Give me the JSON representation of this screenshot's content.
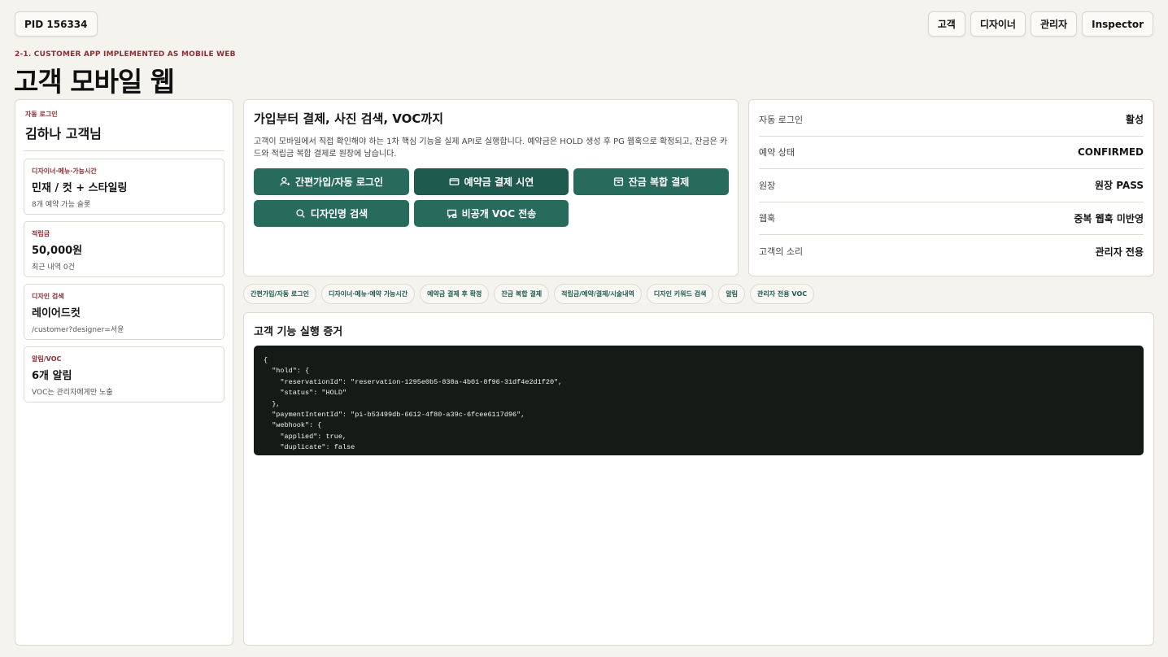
{
  "header": {
    "pid": "PID 156334",
    "roles": [
      "고객",
      "디자이너",
      "관리자",
      "Inspector"
    ],
    "eyebrow": "2-1. CUSTOMER APP IMPLEMENTED AS MOBILE WEB",
    "title": "고객 모바일 웹"
  },
  "left": {
    "login_caption": "자동 로그인",
    "login_name": "김하나 고객님",
    "cards": [
      {
        "caption": "디자이너·메뉴·가능시간",
        "value": "민재 / 컷 + 스타일링",
        "sub": "8개 예약 가능 슬롯"
      },
      {
        "caption": "적립금",
        "value": "50,000원",
        "sub": "최근 내역 0건"
      },
      {
        "caption": "디자인 검색",
        "value": "레이어드컷",
        "sub": "/customer?designer=서윤"
      },
      {
        "caption": "알림/VOC",
        "value": "6개 알림",
        "sub": "VOC는 관리자에게만 노출"
      }
    ]
  },
  "center": {
    "title": "가입부터 결제, 사진 검색, VOC까지",
    "description": "고객이 모바일에서 직접 확인해야 하는 1차 핵심 기능을 실제 API로 실행합니다. 예약금은 HOLD 생성 후 PG 웹훅으로 확정되고, 잔금은 카드와 적립금 복합 결제로 원장에 남습니다.",
    "actions": [
      {
        "label": "간편가입/자동 로그인",
        "icon": "user-plus-icon"
      },
      {
        "label": "예약금 결제 시연",
        "icon": "credit-card-icon"
      },
      {
        "label": "잔금 복합 결제",
        "icon": "wallet-icon"
      },
      {
        "label": "디자인명 검색",
        "icon": "search-icon"
      },
      {
        "label": "비공개 VOC 전송",
        "icon": "message-lock-icon"
      }
    ]
  },
  "status": {
    "rows": [
      {
        "key": "자동 로그인",
        "value": "활성"
      },
      {
        "key": "예약 상태",
        "value": "CONFIRMED"
      },
      {
        "key": "원장",
        "value": "원장 PASS"
      },
      {
        "key": "웹훅",
        "value": "중복 웹훅 미반영"
      },
      {
        "key": "고객의 소리",
        "value": "관리자 전용"
      }
    ]
  },
  "tags": [
    "간편가입/자동 로그인",
    "디자이너·메뉴·예약 가능시간",
    "예약금 결제 후 확정",
    "잔금 복합 결제",
    "적립금/예약/결제/시술내역",
    "디자인 키워드 검색",
    "알림",
    "관리자 전용 VOC"
  ],
  "evidence": {
    "title": "고객 기능 실행 증거",
    "code": "{\n  \"hold\": {\n    \"reservationId\": \"reservation-1295e0b5-838a-4b01-8f96-31df4e2d1f20\",\n    \"status\": \"HOLD\"\n  },\n  \"paymentIntentId\": \"pi-b53499db-6612-4f80-a39c-6fcee6117d96\",\n  \"webhook\": {\n    \"applied\": true,\n    \"duplicate\": false"
  },
  "colors": {
    "accent": "#276b5d",
    "eyebrow": "#8a2f36",
    "background": "#f4f3ee",
    "code_bg": "#151a17"
  }
}
